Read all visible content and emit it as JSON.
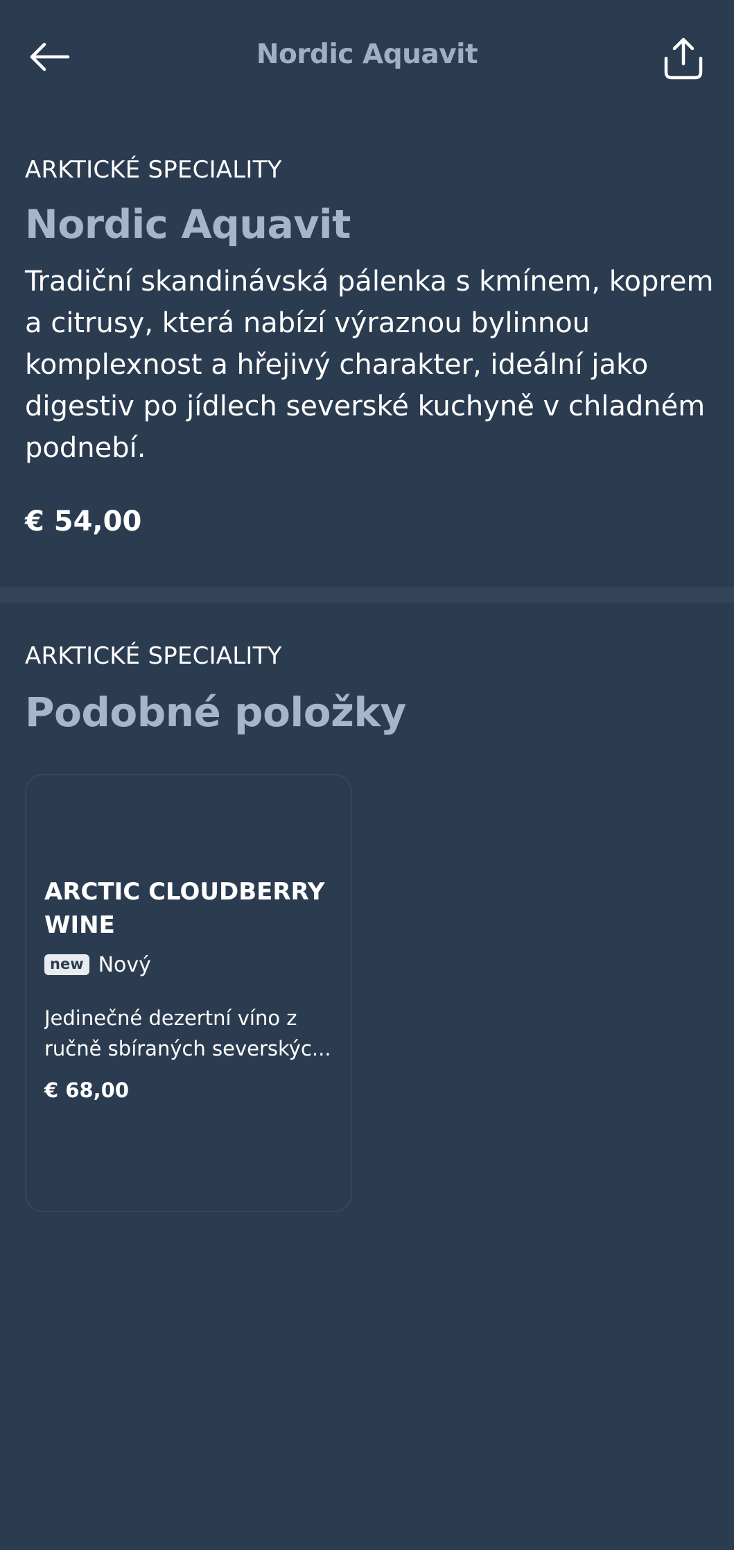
{
  "header": {
    "title": "Nordic Aquavit",
    "back_icon": "arrow-left-icon",
    "share_icon": "share-upload-icon"
  },
  "product": {
    "category": "ARKTICKÉ SPECIALITY",
    "name": "Nordic Aquavit",
    "description": "Tradiční skandinávská pálenka s kmínem, koprem a citrusy, která nabízí výraznou bylinnou komplexnost a hřejivý charakter, ideální jako digestiv po jídlech severské kuchyně v chladném podnebí.",
    "price": "€ 54,00"
  },
  "similar": {
    "category": "ARKTICKÉ SPECIALITY",
    "title": "Podobné položky",
    "items": [
      {
        "title": "ARCTIC CLOUDBERRY WINE",
        "badge": "new",
        "badge_label": "Nový",
        "description_line1": "Jedinečné dezertní víno z",
        "description_line2": "ručně sbíraných severskýc...",
        "price": "€ 68,00"
      }
    ]
  },
  "colors": {
    "background": "#2c3c50",
    "accent_title": "#a5b5cb",
    "divider": "#33445a",
    "text": "#ffffff"
  }
}
